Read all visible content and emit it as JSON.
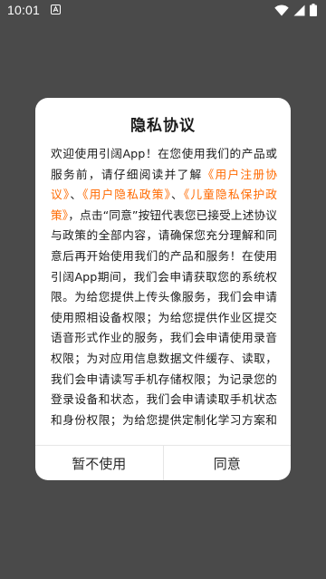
{
  "status_bar": {
    "time": "10:01",
    "icons": [
      "notification-a-icon",
      "wifi-icon",
      "cellular-signal-icon",
      "battery-icon"
    ],
    "icon_color": "#ffffff"
  },
  "dialog": {
    "title": "隐私协议",
    "body": {
      "intro": "欢迎使用引阔App！在您使用我们的产品或服务前，请仔细阅读并了解",
      "link_user_agreement": "《用户注册协议》",
      "sep1": "、",
      "link_privacy_policy": "《用户隐私政策》",
      "sep2": "、",
      "link_child_protection": "《儿童隐私保护政策》",
      "rest": "，点击“同意”按钮代表您已接受上述协议与政策的全部内容，请确保您充分理解和同意后再开始使用我们的产品和服务！在使用引阔App期间，我们会申请获取您的系统权限。为给您提供上传头像服务，我们会申请使用照相设备权限；为给您提供作业区提交语音形式作业的服务，我们会申请使用录音权限；为对应用信息数据文件缓存、读取，我们会申请读写手机存储权限；为记录您的登录设备和状态，我们会申请读取手机状态和身份权限；为给您提供定制化学习方案和专属推广活动的服务，我们会采集您的手机号码"
    },
    "buttons": {
      "decline": "暂不使用",
      "agree": "同意"
    },
    "colors": {
      "link": "#ff6a00",
      "background": "#ffffff",
      "overlay": "#4a4a4a"
    }
  }
}
